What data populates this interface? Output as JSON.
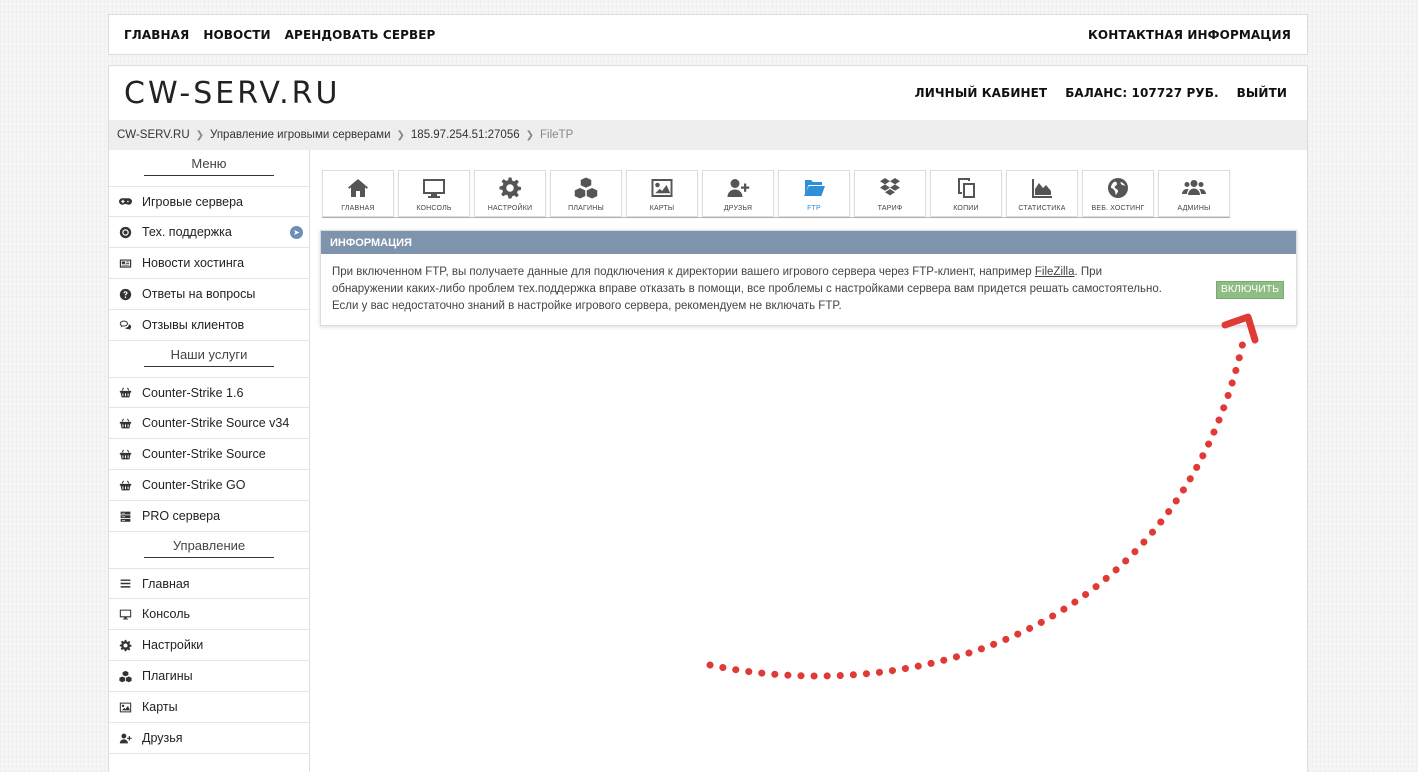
{
  "topnav": {
    "items": [
      "ГЛАВНАЯ",
      "НОВОСТИ",
      "АРЕНДОВАТЬ СЕРВЕР"
    ],
    "contact": "КОНТАКТНАЯ ИНФОРМАЦИЯ"
  },
  "header": {
    "logo": "CW-SERV.RU",
    "cabinet": "ЛИЧНЫЙ КАБИНЕТ",
    "balance": "БАЛАНС: 107727 РУБ.",
    "logout": "ВЫЙТИ"
  },
  "breadcrumb": [
    "CW-SERV.RU",
    "Управление игровыми серверами",
    "185.97.254.51:27056",
    "FileTP"
  ],
  "sidebar": {
    "menu_heading": "Меню",
    "menu": [
      {
        "label": "Игровые сервера",
        "icon": "gamepad-icon"
      },
      {
        "label": "Тех. поддержка",
        "icon": "lifebuoy-icon"
      },
      {
        "label": "Новости хостинга",
        "icon": "newspaper-icon"
      },
      {
        "label": "Ответы на вопросы",
        "icon": "question-icon"
      },
      {
        "label": "Отзывы клиентов",
        "icon": "comments-icon"
      }
    ],
    "services_heading": "Наши услуги",
    "services": [
      {
        "label": "Counter-Strike 1.6",
        "icon": "basket-icon"
      },
      {
        "label": "Counter-Strike Source v34",
        "icon": "basket-icon"
      },
      {
        "label": "Counter-Strike Source",
        "icon": "basket-icon"
      },
      {
        "label": "Counter-Strike GO",
        "icon": "basket-icon"
      },
      {
        "label": "PRO сервера",
        "icon": "server-icon"
      }
    ],
    "manage_heading": "Управление",
    "manage": [
      {
        "label": "Главная",
        "icon": "list-icon"
      },
      {
        "label": "Консоль",
        "icon": "monitor-icon"
      },
      {
        "label": "Настройки",
        "icon": "gear-icon"
      },
      {
        "label": "Плагины",
        "icon": "cubes-icon"
      },
      {
        "label": "Карты",
        "icon": "image-icon"
      },
      {
        "label": "Друзья",
        "icon": "user-plus-icon"
      }
    ]
  },
  "tabs": [
    {
      "label": "ГЛАВНАЯ",
      "icon": "home-icon"
    },
    {
      "label": "КОНСОЛЬ",
      "icon": "monitor-icon"
    },
    {
      "label": "НАСТРОЙКИ",
      "icon": "gear-icon"
    },
    {
      "label": "ПЛАГИНЫ",
      "icon": "cubes-icon"
    },
    {
      "label": "КАРТЫ",
      "icon": "image-icon"
    },
    {
      "label": "ДРУЗЬЯ",
      "icon": "user-plus-icon"
    },
    {
      "label": "FTP",
      "icon": "folder-open-icon",
      "active": true
    },
    {
      "label": "ТАРИФ",
      "icon": "dropbox-icon"
    },
    {
      "label": "КОПИИ",
      "icon": "copy-icon"
    },
    {
      "label": "СТАТИСТИКА",
      "icon": "area-chart-icon"
    },
    {
      "label": "ВЕБ. ХОСТИНГ",
      "icon": "globe-icon"
    },
    {
      "label": "АДМИНЫ",
      "icon": "users-icon"
    }
  ],
  "info": {
    "title": "ИНФОРМАЦИЯ",
    "text_before": "При включенном FTP, вы получаете данные для подключения к директории вашего игрового сервера через FTP-клиент, например ",
    "link": "FileZilla",
    "text_after": ". При обнаружении каких-либо проблем тех.поддержка вправе отказать в помощи, все проблемы с настройками сервера вам придется решать самостоятельно. Если у вас недостаточно знаний в настройке игрового сервера, рекомендуем не включать FTP.",
    "button": "ВКЛЮЧИТЬ"
  },
  "colors": {
    "accent": "#2f8fd8",
    "info_header": "#7e94ac",
    "button": "#8ebd85",
    "arrow": "#e03a36"
  }
}
